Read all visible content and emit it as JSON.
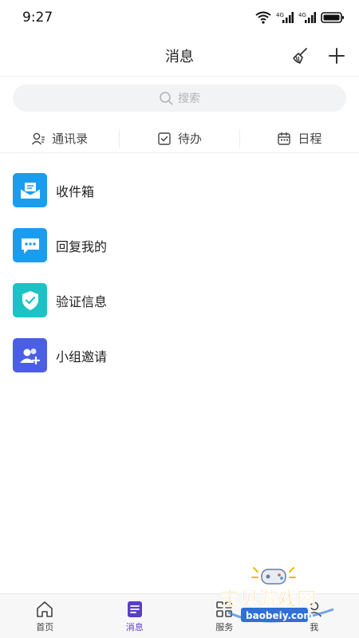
{
  "status_bar": {
    "time": "9:27",
    "signal_label_1": "4G",
    "signal_label_2": "4G"
  },
  "header": {
    "title": "消息"
  },
  "search": {
    "placeholder": "搜索"
  },
  "quick_tabs": [
    {
      "label": "通讯录",
      "icon": "contacts-icon"
    },
    {
      "label": "待办",
      "icon": "checkbox-icon"
    },
    {
      "label": "日程",
      "icon": "calendar-icon"
    }
  ],
  "messages": [
    {
      "label": "收件箱",
      "icon": "envelope-icon",
      "color": "#1a9df0"
    },
    {
      "label": "回复我的",
      "icon": "chat-bubble-icon",
      "color": "#1a9df0"
    },
    {
      "label": "验证信息",
      "icon": "shield-check-icon",
      "color": "#1cc2c6"
    },
    {
      "label": "小组邀请",
      "icon": "group-add-icon",
      "color": "#4a5fe6"
    }
  ],
  "bottom_nav": [
    {
      "label": "首页",
      "icon": "home-icon",
      "active": false
    },
    {
      "label": "消息",
      "icon": "message-doc-icon",
      "active": true
    },
    {
      "label": "服务",
      "icon": "grid-icon",
      "active": false
    },
    {
      "label": "我",
      "icon": "user-icon",
      "active": false
    }
  ],
  "watermark": {
    "brand": "宝贝游戏网",
    "site": "baobeiy.com"
  },
  "colors": {
    "accent": "#5b3ec8",
    "search_bg": "#f2f3f5"
  }
}
